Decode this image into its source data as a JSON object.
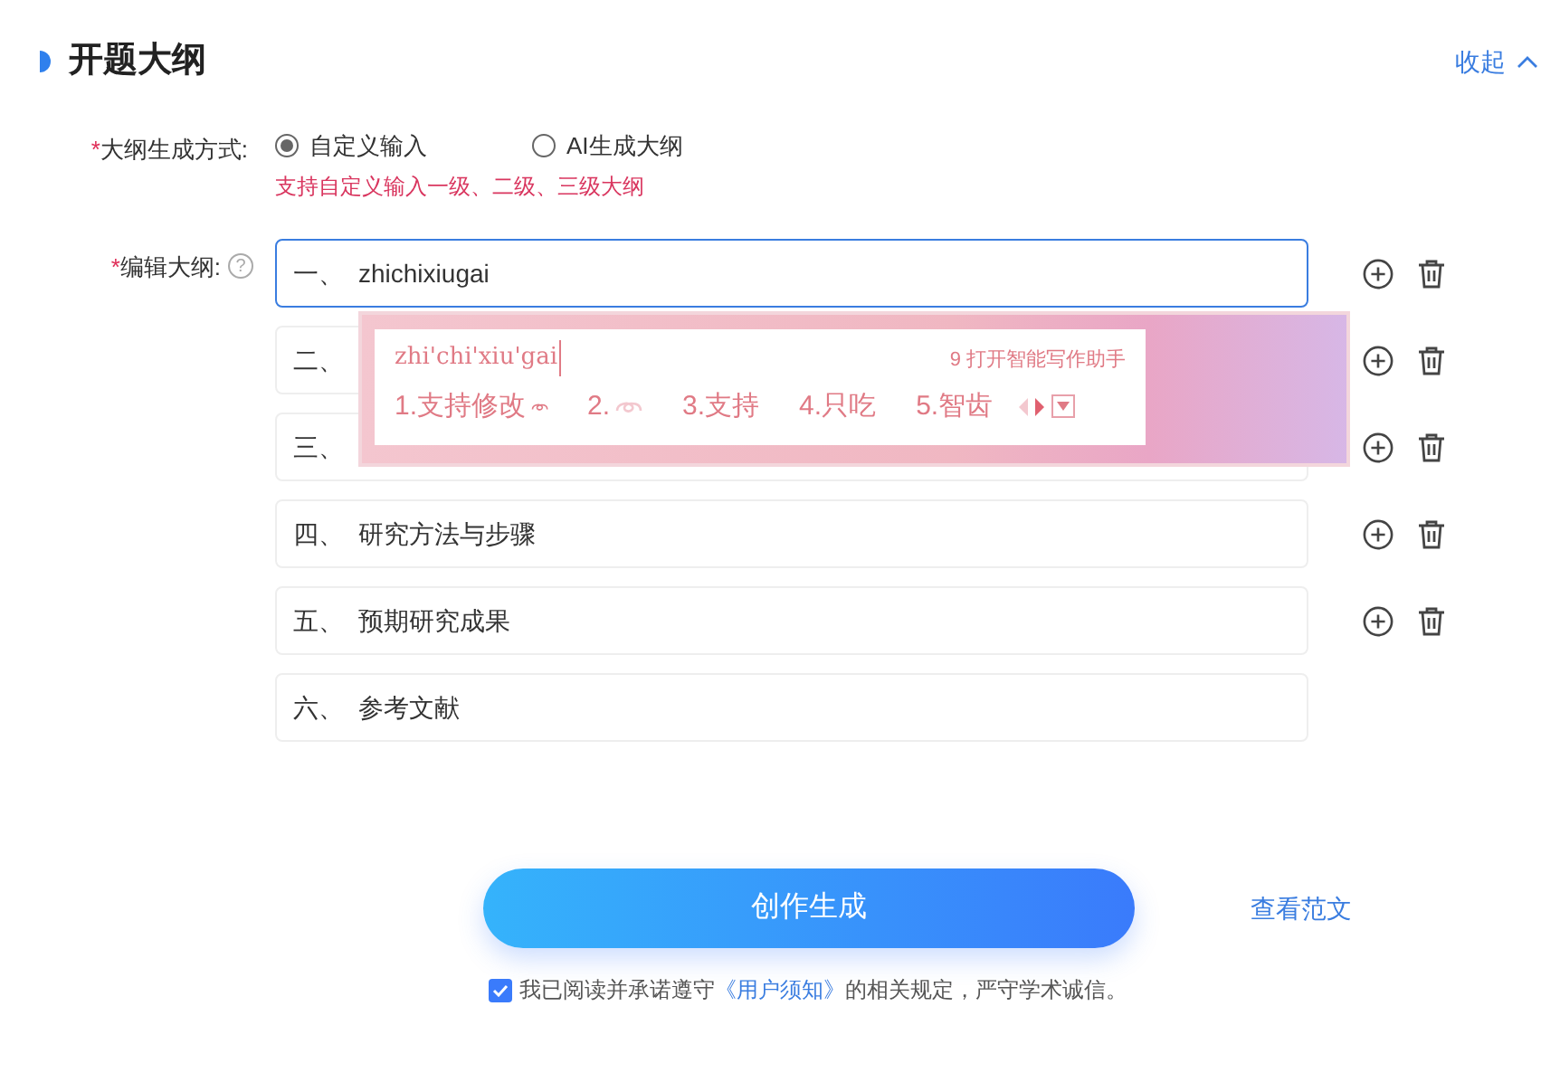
{
  "section": {
    "title": "开题大纲",
    "collapse": "收起"
  },
  "method": {
    "label": "大纲生成方式:",
    "required_mark": "*",
    "options": [
      {
        "label": "自定义输入",
        "selected": true
      },
      {
        "label": "AI生成大纲",
        "selected": false
      }
    ],
    "hint": "支持自定义输入一级、二级、三级大纲"
  },
  "outline": {
    "label": "编辑大纲:",
    "required_mark": "*",
    "help": "?",
    "items": [
      {
        "number": "一、",
        "text": "zhichixiugai",
        "focused": true,
        "actions": true
      },
      {
        "number": "二、",
        "focused": false,
        "actions": true
      },
      {
        "number": "三、",
        "focused": false,
        "actions": true
      },
      {
        "number": "四、",
        "text": "研究方法与步骤",
        "focused": false,
        "actions": true
      },
      {
        "number": "五、",
        "text": "预期研究成果",
        "focused": false,
        "actions": true
      },
      {
        "number": "六、",
        "text": "参考文献",
        "focused": false,
        "actions": false
      }
    ]
  },
  "ime": {
    "composition": "zhi'chi'xiu'gai",
    "assistant": "9 打开智能写作助手",
    "candidates": [
      "1.支持修改",
      "2.",
      "3.支持",
      "4.只吃",
      "5.智齿"
    ]
  },
  "generate_button": "创作生成",
  "sample_link": "查看范文",
  "agreement": {
    "checked": true,
    "before": "我已阅读并承诺遵守",
    "link": "《用户须知》",
    "after": "的相关规定，严守学术诚信。"
  }
}
